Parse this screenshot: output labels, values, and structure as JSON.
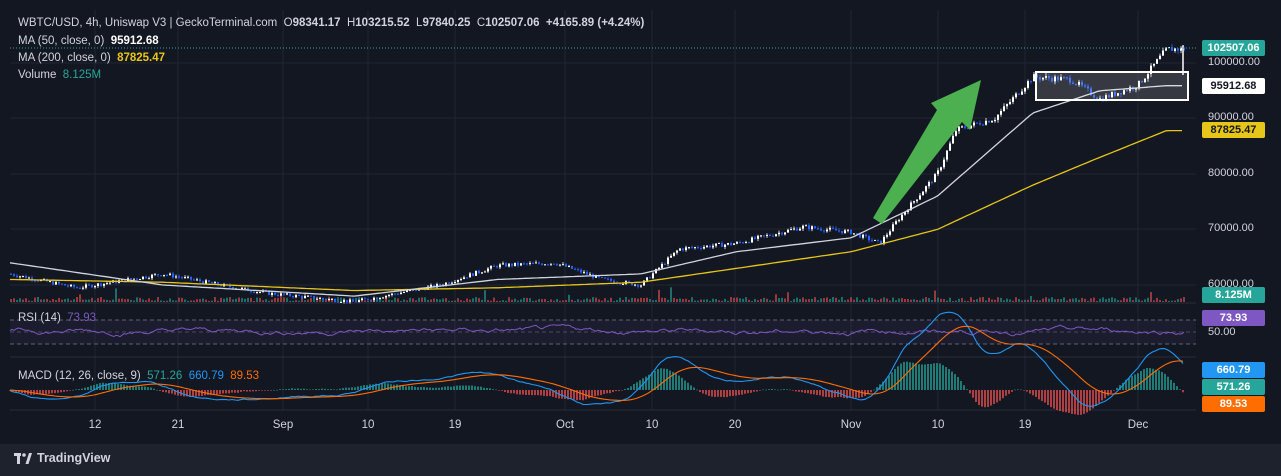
{
  "header": {
    "symbol": "WBTC/USD, 4h, Uniswap V3 | GeckoTerminal.com",
    "o_label": "O",
    "o": "98341.17",
    "h_label": "H",
    "h": "103215.52",
    "l_label": "L",
    "l": "97840.25",
    "c_label": "C",
    "c": "102507.06",
    "change": "+4165.89 (+4.24%)"
  },
  "legends": {
    "ma50_label": "MA (50, close, 0)",
    "ma50_value": "95912.68",
    "ma200_label": "MA (200, close, 0)",
    "ma200_value": "87825.47",
    "volume_label": "Volume",
    "volume_value": "8.125M",
    "rsi_label": "RSI (14)",
    "rsi_value": "73.93",
    "macd_label": "MACD (12, 26, close, 9)",
    "macd_value": "571.26",
    "signal_value": "660.79",
    "hist_value": "89.53"
  },
  "price_axis_labels": [
    "100000.00",
    "90000.00",
    "80000.00",
    "70000.00",
    "60000.00"
  ],
  "tags": {
    "last_price": "102507.06",
    "ma50": "95912.68",
    "ma200": "87825.47",
    "volume": "8.125M",
    "rsi": "73.93",
    "rsi_mid": "50.00",
    "signal": "660.79",
    "macd": "571.26",
    "hist": "89.53"
  },
  "x_ticks": [
    "12",
    "21",
    "Sep",
    "10",
    "19",
    "Oct",
    "10",
    "20",
    "Nov",
    "10",
    "19",
    "Dec"
  ],
  "footer": {
    "brand": "TradingView"
  },
  "colors": {
    "background": "#131722",
    "up": "#ffffff",
    "down": "#2962ff",
    "ma50": "#d1d4dc",
    "ma200": "#e6c619",
    "rsi": "#7e57c2",
    "macd": "#2196f3",
    "signal": "#ff6d00",
    "volume": "#26a69a",
    "arrow": "#4caf50"
  },
  "chart_data": {
    "type": "line",
    "title": "WBTC/USD, 4h, Uniswap V3",
    "ylim": [
      55000,
      104000
    ],
    "grid": true,
    "series": [
      {
        "name": "WBTC/USD",
        "x": [
          "Aug 5",
          "Aug 12",
          "Aug 21",
          "Aug 27",
          "Sep 1",
          "Sep 10",
          "Sep 19",
          "Sep 25",
          "Oct 1",
          "Oct 6",
          "Oct 10",
          "Oct 14",
          "Oct 20",
          "Oct 27",
          "Nov 1",
          "Nov 4",
          "Nov 6",
          "Nov 10",
          "Nov 12",
          "Nov 16",
          "Nov 20",
          "Nov 24",
          "Nov 27",
          "Dec 1",
          "Dec 4"
        ],
        "values": [
          62000,
          59500,
          62000,
          60000,
          58500,
          57000,
          60000,
          63500,
          64000,
          61000,
          60000,
          66500,
          67500,
          70500,
          69500,
          67500,
          72000,
          80000,
          88000,
          90000,
          97500,
          97000,
          93500,
          96000,
          102507
        ]
      },
      {
        "name": "MA (50, close, 0)",
        "x": [
          "Aug 5",
          "Aug 21",
          "Sep 10",
          "Sep 25",
          "Oct 10",
          "Oct 20",
          "Nov 1",
          "Nov 10",
          "Nov 20",
          "Nov 27",
          "Dec 4"
        ],
        "values": [
          64000,
          60000,
          58000,
          61000,
          62000,
          66000,
          68500,
          76000,
          91000,
          95000,
          95912
        ]
      },
      {
        "name": "MA (200, close, 0)",
        "x": [
          "Aug 5",
          "Aug 21",
          "Sep 10",
          "Sep 25",
          "Oct 10",
          "Oct 20",
          "Nov 1",
          "Nov 10",
          "Nov 20",
          "Nov 27",
          "Dec 4"
        ],
        "values": [
          61000,
          60500,
          59000,
          59500,
          60500,
          63000,
          66000,
          70000,
          78000,
          83000,
          87825
        ]
      }
    ],
    "annotations": [
      "green up-arrow Nov 12 to Nov 16",
      "white rectangle consolidation Nov 21 to Dec 4 (~93500-98500)"
    ]
  }
}
